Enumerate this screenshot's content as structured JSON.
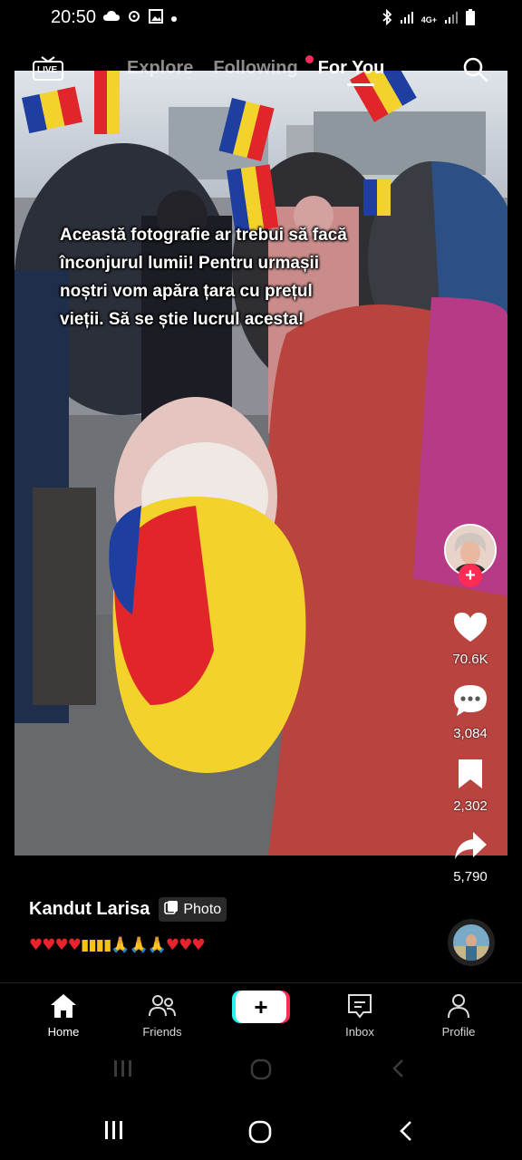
{
  "status_bar": {
    "time": "20:50",
    "network": "4G+"
  },
  "top_nav": {
    "live_label": "LIVE",
    "tabs": [
      {
        "label": "Explore",
        "active": false
      },
      {
        "label": "Following",
        "active": false,
        "notification_dot": true
      },
      {
        "label": "For You",
        "active": true
      }
    ]
  },
  "post": {
    "overlay_lines": [
      "Această fotografie ar trebui să facă",
      "înconjurul lumii! Pentru urmașii",
      "noștri vom apăra țara cu prețul",
      "vieții. Să se știe lucrul acesta!"
    ],
    "author": "Kandut Larisa",
    "type_badge": "Photo",
    "caption": {
      "hearts_1": "♥♥♥♥",
      "flags": "▮▮▮▮",
      "prayers": "🙏🙏🙏",
      "hearts_2": "♥♥♥"
    },
    "likes": "70.6K",
    "comments": "3,084",
    "saves": "2,302",
    "shares": "5,790"
  },
  "tab_bar": {
    "home": "Home",
    "friends": "Friends",
    "create": "+",
    "inbox": "Inbox",
    "profile": "Profile"
  },
  "colors": {
    "accent_red": "#fe2c55",
    "accent_cyan": "#25f4ee",
    "flag_blue": "#1f3fa0",
    "flag_yellow": "#f3d22b",
    "flag_red": "#e0262b"
  }
}
